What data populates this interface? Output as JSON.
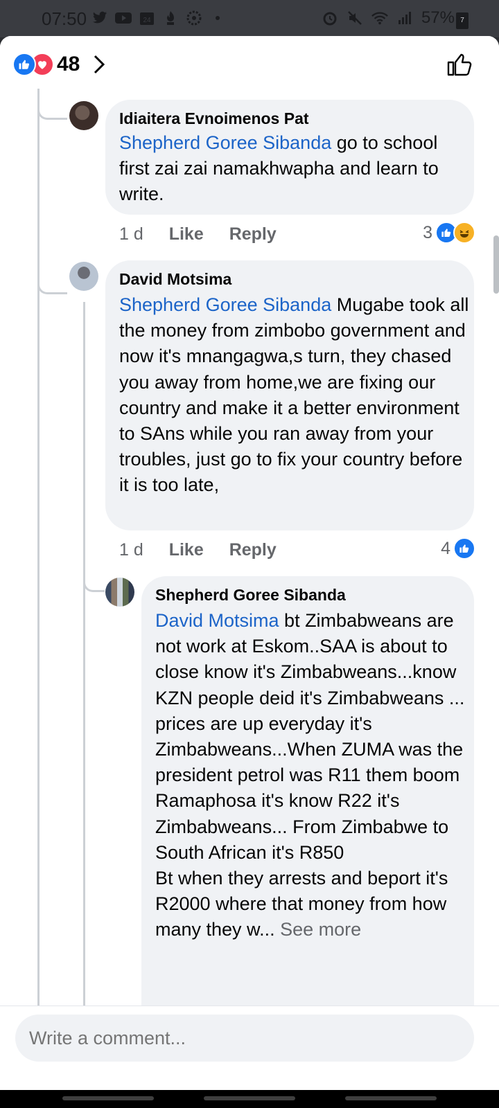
{
  "status_bar": {
    "time": "07:50",
    "battery": "57%",
    "battery_level_badge": "7",
    "left_icons": [
      "twitter-icon",
      "youtube-icon",
      "calendar-icon",
      "notification-icon",
      "settings-dot-icon",
      "dot-icon"
    ],
    "right_icons": [
      "alarm-icon",
      "mute-icon",
      "wifi-icon",
      "signal-icon"
    ]
  },
  "header": {
    "reaction_count": "48",
    "reactions": [
      "like",
      "love"
    ]
  },
  "comments": [
    {
      "author": "Idiaitera Evnoimenos Pat",
      "mention": "Shepherd Goree Sibanda",
      "text": " go to school first zai zai namakhwapha and learn to write.",
      "time": "1 d",
      "like_label": "Like",
      "reply_label": "Reply",
      "reaction_count": "3"
    },
    {
      "author": "David Motsima",
      "mention": "Shepherd Goree Sibanda",
      "text": " Mugabe took all the money from zimbobo government and now it's mnangagwa,s turn, they chased you away from home,we are fixing our country and make it a better environment to SAns while you ran away from your troubles, just go to fix your country before it is too late,",
      "time": "1 d",
      "like_label": "Like",
      "reply_label": "Reply",
      "reaction_count": "4"
    },
    {
      "author": "Shepherd Goree Sibanda",
      "mention": "David Motsima",
      "text": " bt Zimbabweans are not work at Eskom..SAA is about to close know it's Zimbabweans...know KZN people deid it's Zimbabweans ... prices are up everyday it's Zimbabweans...When ZUMA was the president petrol was R11 them boom Ramaphosa it's know R22 it's Zimbabweans... From Zimbabwe to South African it's R850",
      "text2": "Bt when they arrests and beport it's R2000 where that money from how many they w... ",
      "see_more": "See more"
    }
  ],
  "composer": {
    "placeholder": "Write a comment..."
  }
}
